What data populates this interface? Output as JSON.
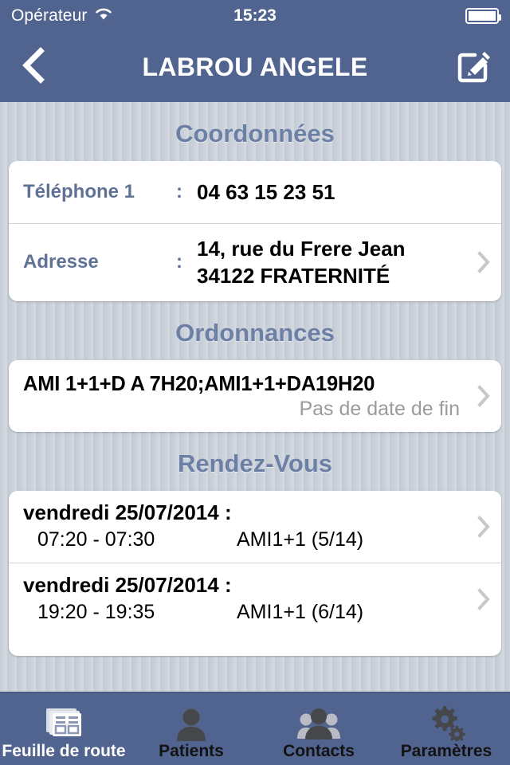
{
  "statusbar": {
    "carrier": "Opérateur",
    "wifi_icon": "wifi-icon",
    "time": "15:23",
    "battery_icon": "battery-icon"
  },
  "navbar": {
    "back_icon": "chevron-left-icon",
    "title": "LABROU ANGELE",
    "edit_icon": "compose-edit-icon",
    "background_color": "#51648f"
  },
  "sections": {
    "coordonnees": {
      "title": "Coordonnées",
      "rows": [
        {
          "label": "Téléphone 1",
          "colon": ":",
          "value": "04 63 15 23 51",
          "has_chevron": false
        },
        {
          "label": "Adresse",
          "colon": ":",
          "value": "14, rue du Frere Jean\n34122 FRATERNITÉ",
          "has_chevron": true
        }
      ]
    },
    "ordonnances": {
      "title": "Ordonnances",
      "items": [
        {
          "title": "AMI 1+1+D A 7H20;AMI1+1+DA19H20",
          "subtitle": "Pas de date de fin",
          "has_chevron": true
        }
      ]
    },
    "rendez_vous": {
      "title": "Rendez-Vous",
      "items": [
        {
          "date": "vendredi 25/07/2014 :",
          "time": "07:20 - 07:30",
          "code": "AMI1+1 (5/14)",
          "has_chevron": true
        },
        {
          "date": "vendredi 25/07/2014 :",
          "time": "19:20 - 19:35",
          "code": "AMI1+1 (6/14)",
          "has_chevron": true
        }
      ]
    }
  },
  "tabbar": {
    "items": [
      {
        "label": "Feuille de route",
        "icon": "documents-stack-icon",
        "active": true
      },
      {
        "label": "Patients",
        "icon": "person-icon",
        "active": false
      },
      {
        "label": "Contacts",
        "icon": "people-group-icon",
        "active": false
      },
      {
        "label": "Paramètres",
        "icon": "gears-icon",
        "active": false
      }
    ]
  },
  "colors": {
    "accent_blue": "#51648f",
    "section_heading": "#6c7fa5",
    "field_label": "#5f7296",
    "muted_text": "#9b9b9b",
    "chevron": "#c7c7cc"
  }
}
